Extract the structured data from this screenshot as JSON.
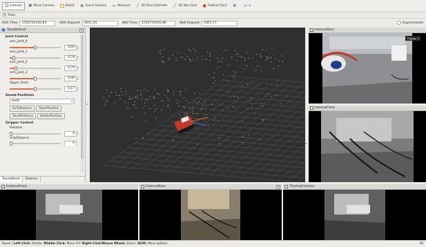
{
  "toolbar": {
    "items": [
      {
        "label": "Interact",
        "icon": "interact-icon",
        "active": true
      },
      {
        "label": "Move Camera",
        "icon": "move-camera-icon"
      },
      {
        "label": "Select",
        "icon": "select-icon"
      },
      {
        "label": "Focus Camera",
        "icon": "focus-camera-icon"
      },
      {
        "label": "Measure",
        "icon": "measure-icon"
      },
      {
        "label": "2D Pose Estimate",
        "icon": "pose-estimate-icon"
      },
      {
        "label": "2D Nav Goal",
        "icon": "nav-goal-icon"
      },
      {
        "label": "Publish Point",
        "icon": "publish-point-icon"
      }
    ],
    "colors": {
      "pose": "#3aa03a",
      "nav": "#3aa03a",
      "point": "#d23c2c",
      "plus": "#3a6ed8"
    }
  },
  "time": {
    "panel_title": "Time",
    "ros_time_label": "ROS Time:",
    "ros_time": "1550754100.83",
    "ros_elapsed_label": "ROS Elapsed:",
    "ros_elapsed": "1001.24",
    "wall_time_label": "Wall Time:",
    "wall_time": "1550754100.86",
    "wall_elapsed_label": "Wall Elapsed:",
    "wall_elapsed": "1001.17",
    "experimental": "Experimental"
  },
  "left_panel": {
    "title": "TaurobPanel",
    "joint_control_title": "Joint Control",
    "joints": [
      {
        "name": "arm_joint_0",
        "value": "0,00",
        "fraction": 0.5
      },
      {
        "name": "arm_joint_1",
        "value": "0,79",
        "fraction": 0.08
      },
      {
        "name": "arm_joint_2",
        "value": "0,79",
        "fraction": 0.12
      },
      {
        "name": "arm_joint_3",
        "value": "0,00",
        "fraction": 0.5
      },
      {
        "name": "flipper_front",
        "value": "0,17",
        "fraction": 0.5
      }
    ],
    "saved_positions_title": "Saved Positions",
    "saved_selected": "test2",
    "buttons_row1": [
      "GoToPosition",
      "TeachPosition"
    ],
    "buttons_row2": [
      "SavePositions",
      "DeletePosition"
    ],
    "gripper_title": "Gripper Control",
    "rotation_label": "Rotation",
    "rotation_value": "0",
    "grip_label": "GripDistance",
    "grip_value": "0",
    "tabs": [
      "TaurobPanel",
      "Displays"
    ]
  },
  "cameras": {
    "internal_rear": "InternalRear",
    "internal_front": "InternalFront",
    "external_front": "ExternalFront",
    "external_rear": "ExternalRear",
    "thermal": "ThermalCamera",
    "overlay_badge": "Frame: 1"
  },
  "status": {
    "reset": "Reset",
    "left": "Left-Click:",
    "left_desc": "Rotate.",
    "middle": "Middle-Click:",
    "middle_desc": "Move X/Y.",
    "right": "Right-Click/Mouse Wheel:",
    "right_desc": "Zoom.",
    "shift": "Shift:",
    "shift_desc": "More options.",
    "fps": "30"
  }
}
